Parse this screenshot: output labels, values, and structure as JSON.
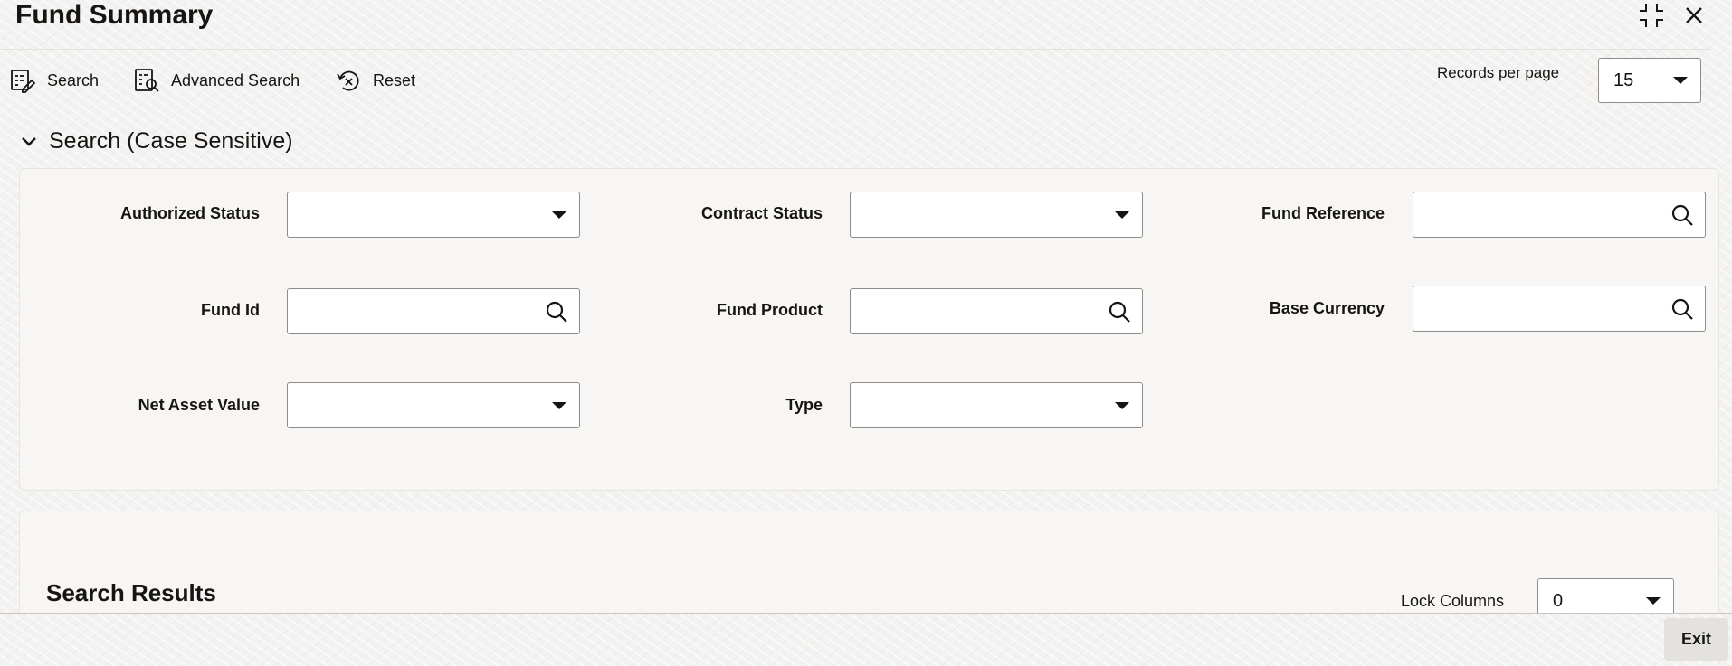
{
  "window": {
    "title": "Fund Summary",
    "maximize_icon": "maximize-icon",
    "close_icon": "close-icon"
  },
  "toolbar": {
    "search_label": "Search",
    "advanced_search_label": "Advanced Search",
    "reset_label": "Reset",
    "records_per_page_label": "Records per page",
    "records_per_page_value": "15"
  },
  "search_section": {
    "title": "Search (Case Sensitive)",
    "fields": {
      "authorized_status": {
        "label": "Authorized Status",
        "value": ""
      },
      "contract_status": {
        "label": "Contract Status",
        "value": ""
      },
      "fund_reference": {
        "label": "Fund Reference",
        "value": ""
      },
      "fund_id": {
        "label": "Fund Id",
        "value": ""
      },
      "fund_product": {
        "label": "Fund Product",
        "value": ""
      },
      "base_currency": {
        "label": "Base Currency",
        "value": ""
      },
      "net_asset_value": {
        "label": "Net Asset Value",
        "value": ""
      },
      "type": {
        "label": "Type",
        "value": ""
      }
    }
  },
  "results": {
    "title": "Search Results",
    "lock_columns_label": "Lock Columns",
    "lock_columns_value": "0"
  },
  "footer": {
    "exit_label": "Exit"
  }
}
